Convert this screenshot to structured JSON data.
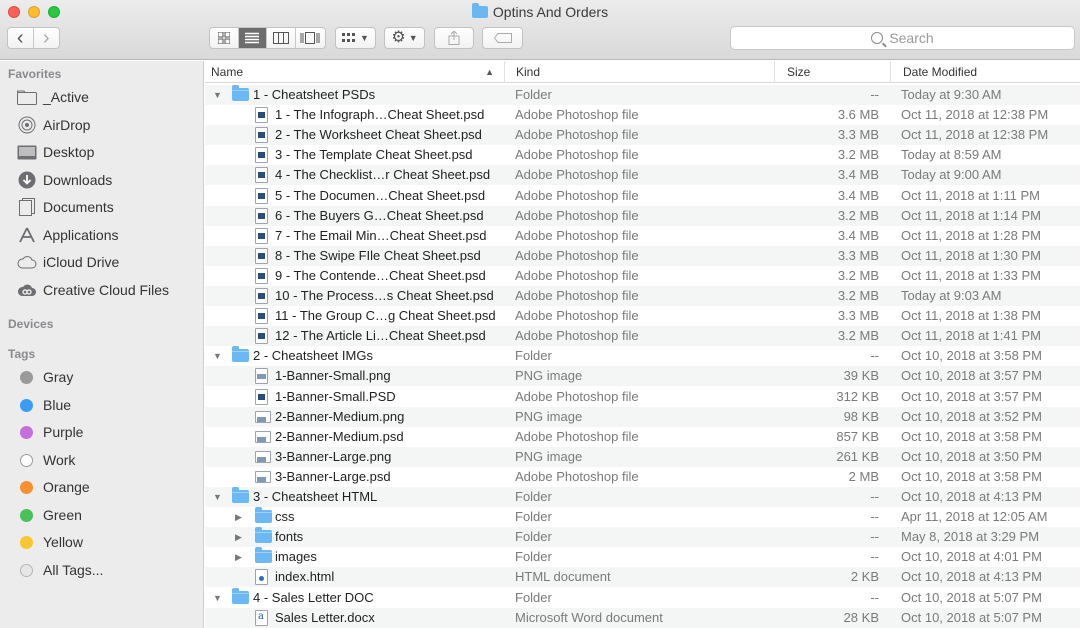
{
  "window": {
    "title": "Optins And Orders"
  },
  "toolbar": {
    "back": "‹",
    "forward": "›",
    "search_placeholder": "Search"
  },
  "sidebar": {
    "favorites_header": "Favorites",
    "favorites": [
      {
        "label": "_Active",
        "icon": "folder-icon"
      },
      {
        "label": "AirDrop",
        "icon": "airdrop-icon"
      },
      {
        "label": "Desktop",
        "icon": "desktop-icon"
      },
      {
        "label": "Downloads",
        "icon": "downloads-icon"
      },
      {
        "label": "Documents",
        "icon": "documents-icon"
      },
      {
        "label": "Applications",
        "icon": "applications-icon"
      },
      {
        "label": "iCloud Drive",
        "icon": "cloud-icon"
      },
      {
        "label": "Creative Cloud Files",
        "icon": "creative-cloud-icon"
      }
    ],
    "devices_header": "Devices",
    "tags_header": "Tags",
    "tags": [
      {
        "label": "Gray",
        "color": "#9a9a9a"
      },
      {
        "label": "Blue",
        "color": "#3a9cf5"
      },
      {
        "label": "Purple",
        "color": "#c36fdc"
      },
      {
        "label": "Work",
        "color": "#ffffff"
      },
      {
        "label": "Orange",
        "color": "#f7902e"
      },
      {
        "label": "Green",
        "color": "#48c158"
      },
      {
        "label": "Yellow",
        "color": "#f7c731"
      },
      {
        "label": "All Tags...",
        "color": "#e6e6e6"
      }
    ]
  },
  "columns": {
    "name": "Name",
    "kind": "Kind",
    "size": "Size",
    "date": "Date Modified"
  },
  "rows": [
    {
      "level": 0,
      "type": "folder",
      "expanded": true,
      "name": "1 - Cheatsheet PSDs",
      "kind": "Folder",
      "size": "--",
      "date": "Today at 9:30 AM"
    },
    {
      "level": 1,
      "type": "psd",
      "name": "1 - The Infograph…Cheat Sheet.psd",
      "kind": "Adobe Photoshop file",
      "size": "3.6 MB",
      "date": "Oct 11, 2018 at 12:38 PM"
    },
    {
      "level": 1,
      "type": "psd",
      "name": "2 - The Worksheet Cheat Sheet.psd",
      "kind": "Adobe Photoshop file",
      "size": "3.3 MB",
      "date": "Oct 11, 2018 at 12:38 PM"
    },
    {
      "level": 1,
      "type": "psd",
      "name": "3 - The Template Cheat Sheet.psd",
      "kind": "Adobe Photoshop file",
      "size": "3.2 MB",
      "date": "Today at 8:59 AM"
    },
    {
      "level": 1,
      "type": "psd",
      "name": "4 - The Checklist…r Cheat Sheet.psd",
      "kind": "Adobe Photoshop file",
      "size": "3.4 MB",
      "date": "Today at 9:00 AM"
    },
    {
      "level": 1,
      "type": "psd",
      "name": "5 - The Documen…Cheat Sheet.psd",
      "kind": "Adobe Photoshop file",
      "size": "3.4 MB",
      "date": "Oct 11, 2018 at 1:11 PM"
    },
    {
      "level": 1,
      "type": "psd",
      "name": "6 - The Buyers G…Cheat Sheet.psd",
      "kind": "Adobe Photoshop file",
      "size": "3.2 MB",
      "date": "Oct 11, 2018 at 1:14 PM"
    },
    {
      "level": 1,
      "type": "psd",
      "name": "7 - The Email Min…Cheat Sheet.psd",
      "kind": "Adobe Photoshop file",
      "size": "3.4 MB",
      "date": "Oct 11, 2018 at 1:28 PM"
    },
    {
      "level": 1,
      "type": "psd",
      "name": "8 - The Swipe FIle Cheat Sheet.psd",
      "kind": "Adobe Photoshop file",
      "size": "3.3 MB",
      "date": "Oct 11, 2018 at 1:30 PM"
    },
    {
      "level": 1,
      "type": "psd",
      "name": "9 - The Contende…Cheat Sheet.psd",
      "kind": "Adobe Photoshop file",
      "size": "3.2 MB",
      "date": "Oct 11, 2018 at 1:33 PM"
    },
    {
      "level": 1,
      "type": "psd",
      "name": "10 - The Process…s Cheat Sheet.psd",
      "kind": "Adobe Photoshop file",
      "size": "3.2 MB",
      "date": "Today at 9:03 AM"
    },
    {
      "level": 1,
      "type": "psd",
      "name": "11 - The Group C…g Cheat Sheet.psd",
      "kind": "Adobe Photoshop file",
      "size": "3.3 MB",
      "date": "Oct 11, 2018 at 1:38 PM"
    },
    {
      "level": 1,
      "type": "psd",
      "name": "12 - The Article Li…Cheat Sheet.psd",
      "kind": "Adobe Photoshop file",
      "size": "3.2 MB",
      "date": "Oct 11, 2018 at 1:41 PM"
    },
    {
      "level": 0,
      "type": "folder",
      "expanded": true,
      "name": "2 - Cheatsheet IMGs",
      "kind": "Folder",
      "size": "--",
      "date": "Oct 10, 2018 at 3:58 PM"
    },
    {
      "level": 1,
      "type": "png",
      "name": "1-Banner-Small.png",
      "kind": "PNG image",
      "size": "39 KB",
      "date": "Oct 10, 2018 at 3:57 PM"
    },
    {
      "level": 1,
      "type": "psd",
      "name": "1-Banner-Small.PSD",
      "kind": "Adobe Photoshop file",
      "size": "312 KB",
      "date": "Oct 10, 2018 at 3:57 PM"
    },
    {
      "level": 1,
      "type": "pngwide",
      "name": "2-Banner-Medium.png",
      "kind": "PNG image",
      "size": "98 KB",
      "date": "Oct 10, 2018 at 3:52 PM"
    },
    {
      "level": 1,
      "type": "pngwide",
      "name": "2-Banner-Medium.psd",
      "kind": "Adobe Photoshop file",
      "size": "857 KB",
      "date": "Oct 10, 2018 at 3:58 PM"
    },
    {
      "level": 1,
      "type": "pngwide",
      "name": "3-Banner-Large.png",
      "kind": "PNG image",
      "size": "261 KB",
      "date": "Oct 10, 2018 at 3:50 PM"
    },
    {
      "level": 1,
      "type": "pngwide",
      "name": "3-Banner-Large.psd",
      "kind": "Adobe Photoshop file",
      "size": "2 MB",
      "date": "Oct 10, 2018 at 3:58 PM"
    },
    {
      "level": 0,
      "type": "folder",
      "expanded": true,
      "name": "3 - Cheatsheet HTML",
      "kind": "Folder",
      "size": "--",
      "date": "Oct 10, 2018 at 4:13 PM"
    },
    {
      "level": 1,
      "type": "folder",
      "expanded": false,
      "name": "css",
      "kind": "Folder",
      "size": "--",
      "date": "Apr 11, 2018 at 12:05 AM"
    },
    {
      "level": 1,
      "type": "folder",
      "expanded": false,
      "name": "fonts",
      "kind": "Folder",
      "size": "--",
      "date": "May 8, 2018 at 3:29 PM"
    },
    {
      "level": 1,
      "type": "folder",
      "expanded": false,
      "name": "images",
      "kind": "Folder",
      "size": "--",
      "date": "Oct 10, 2018 at 4:01 PM"
    },
    {
      "level": 1,
      "type": "html",
      "name": "index.html",
      "kind": "HTML document",
      "size": "2 KB",
      "date": "Oct 10, 2018 at 4:13 PM"
    },
    {
      "level": 0,
      "type": "folder",
      "expanded": true,
      "name": "4 - Sales Letter DOC",
      "kind": "Folder",
      "size": "--",
      "date": "Oct 10, 2018 at 5:07 PM"
    },
    {
      "level": 1,
      "type": "docx",
      "name": "Sales Letter.docx",
      "kind": "Microsoft Word document",
      "size": "28 KB",
      "date": "Oct 10, 2018 at 5:07 PM"
    }
  ]
}
